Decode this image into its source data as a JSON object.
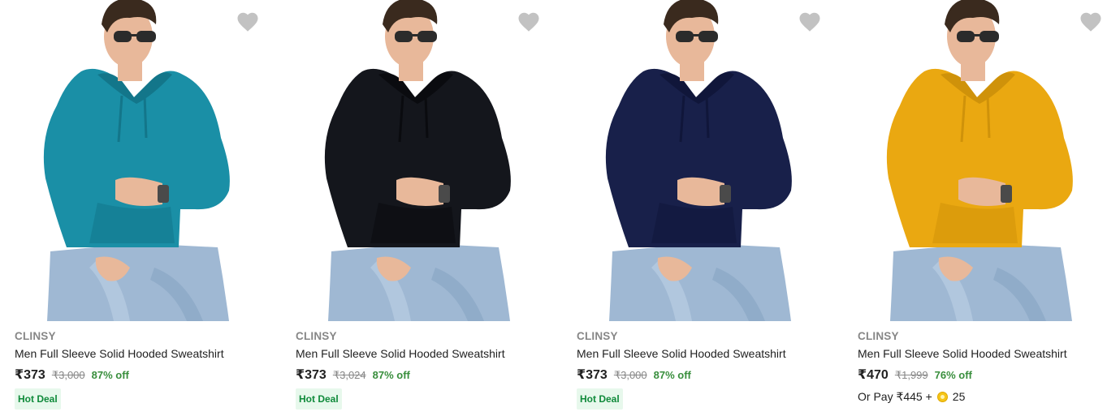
{
  "products": [
    {
      "brand": "CLINSY",
      "title": "Men Full Sleeve Solid Hooded Sweatshirt",
      "price": "₹373",
      "mrp": "₹3,000",
      "discount": "87% off",
      "badge": "Hot Deal",
      "hoodie_color": "#1a8fa6",
      "hoodie_shade": "#13768a",
      "wishlist_icon": "heart-icon"
    },
    {
      "brand": "CLINSY",
      "title": "Men Full Sleeve Solid Hooded Sweatshirt",
      "price": "₹373",
      "mrp": "₹3,024",
      "discount": "87% off",
      "badge": "Hot Deal",
      "hoodie_color": "#14161c",
      "hoodie_shade": "#0a0b0f",
      "wishlist_icon": "heart-icon"
    },
    {
      "brand": "CLINSY",
      "title": "Men Full Sleeve Solid Hooded Sweatshirt",
      "price": "₹373",
      "mrp": "₹3,000",
      "discount": "87% off",
      "badge": "Hot Deal",
      "hoodie_color": "#18204a",
      "hoodie_shade": "#10163a",
      "wishlist_icon": "heart-icon"
    },
    {
      "brand": "CLINSY",
      "title": "Men Full Sleeve Solid Hooded Sweatshirt",
      "price": "₹470",
      "mrp": "₹1,999",
      "discount": "76% off",
      "pay_with": {
        "prefix": "Or Pay ₹445 +",
        "coins": "25",
        "coin_icon": "supercoin-icon"
      },
      "hoodie_color": "#eaa811",
      "hoodie_shade": "#cf920a",
      "wishlist_icon": "heart-icon"
    }
  ],
  "colors": {
    "discount_green": "#388e3c",
    "badge_bg": "#e7f8ec",
    "badge_text": "#0f8a3a",
    "brand_grey": "#878787",
    "wishlist_grey": "#c2c2c2",
    "jeans_blue": "#9fb8d3",
    "skin": "#e8b89a",
    "hair": "#3a2a1e"
  }
}
